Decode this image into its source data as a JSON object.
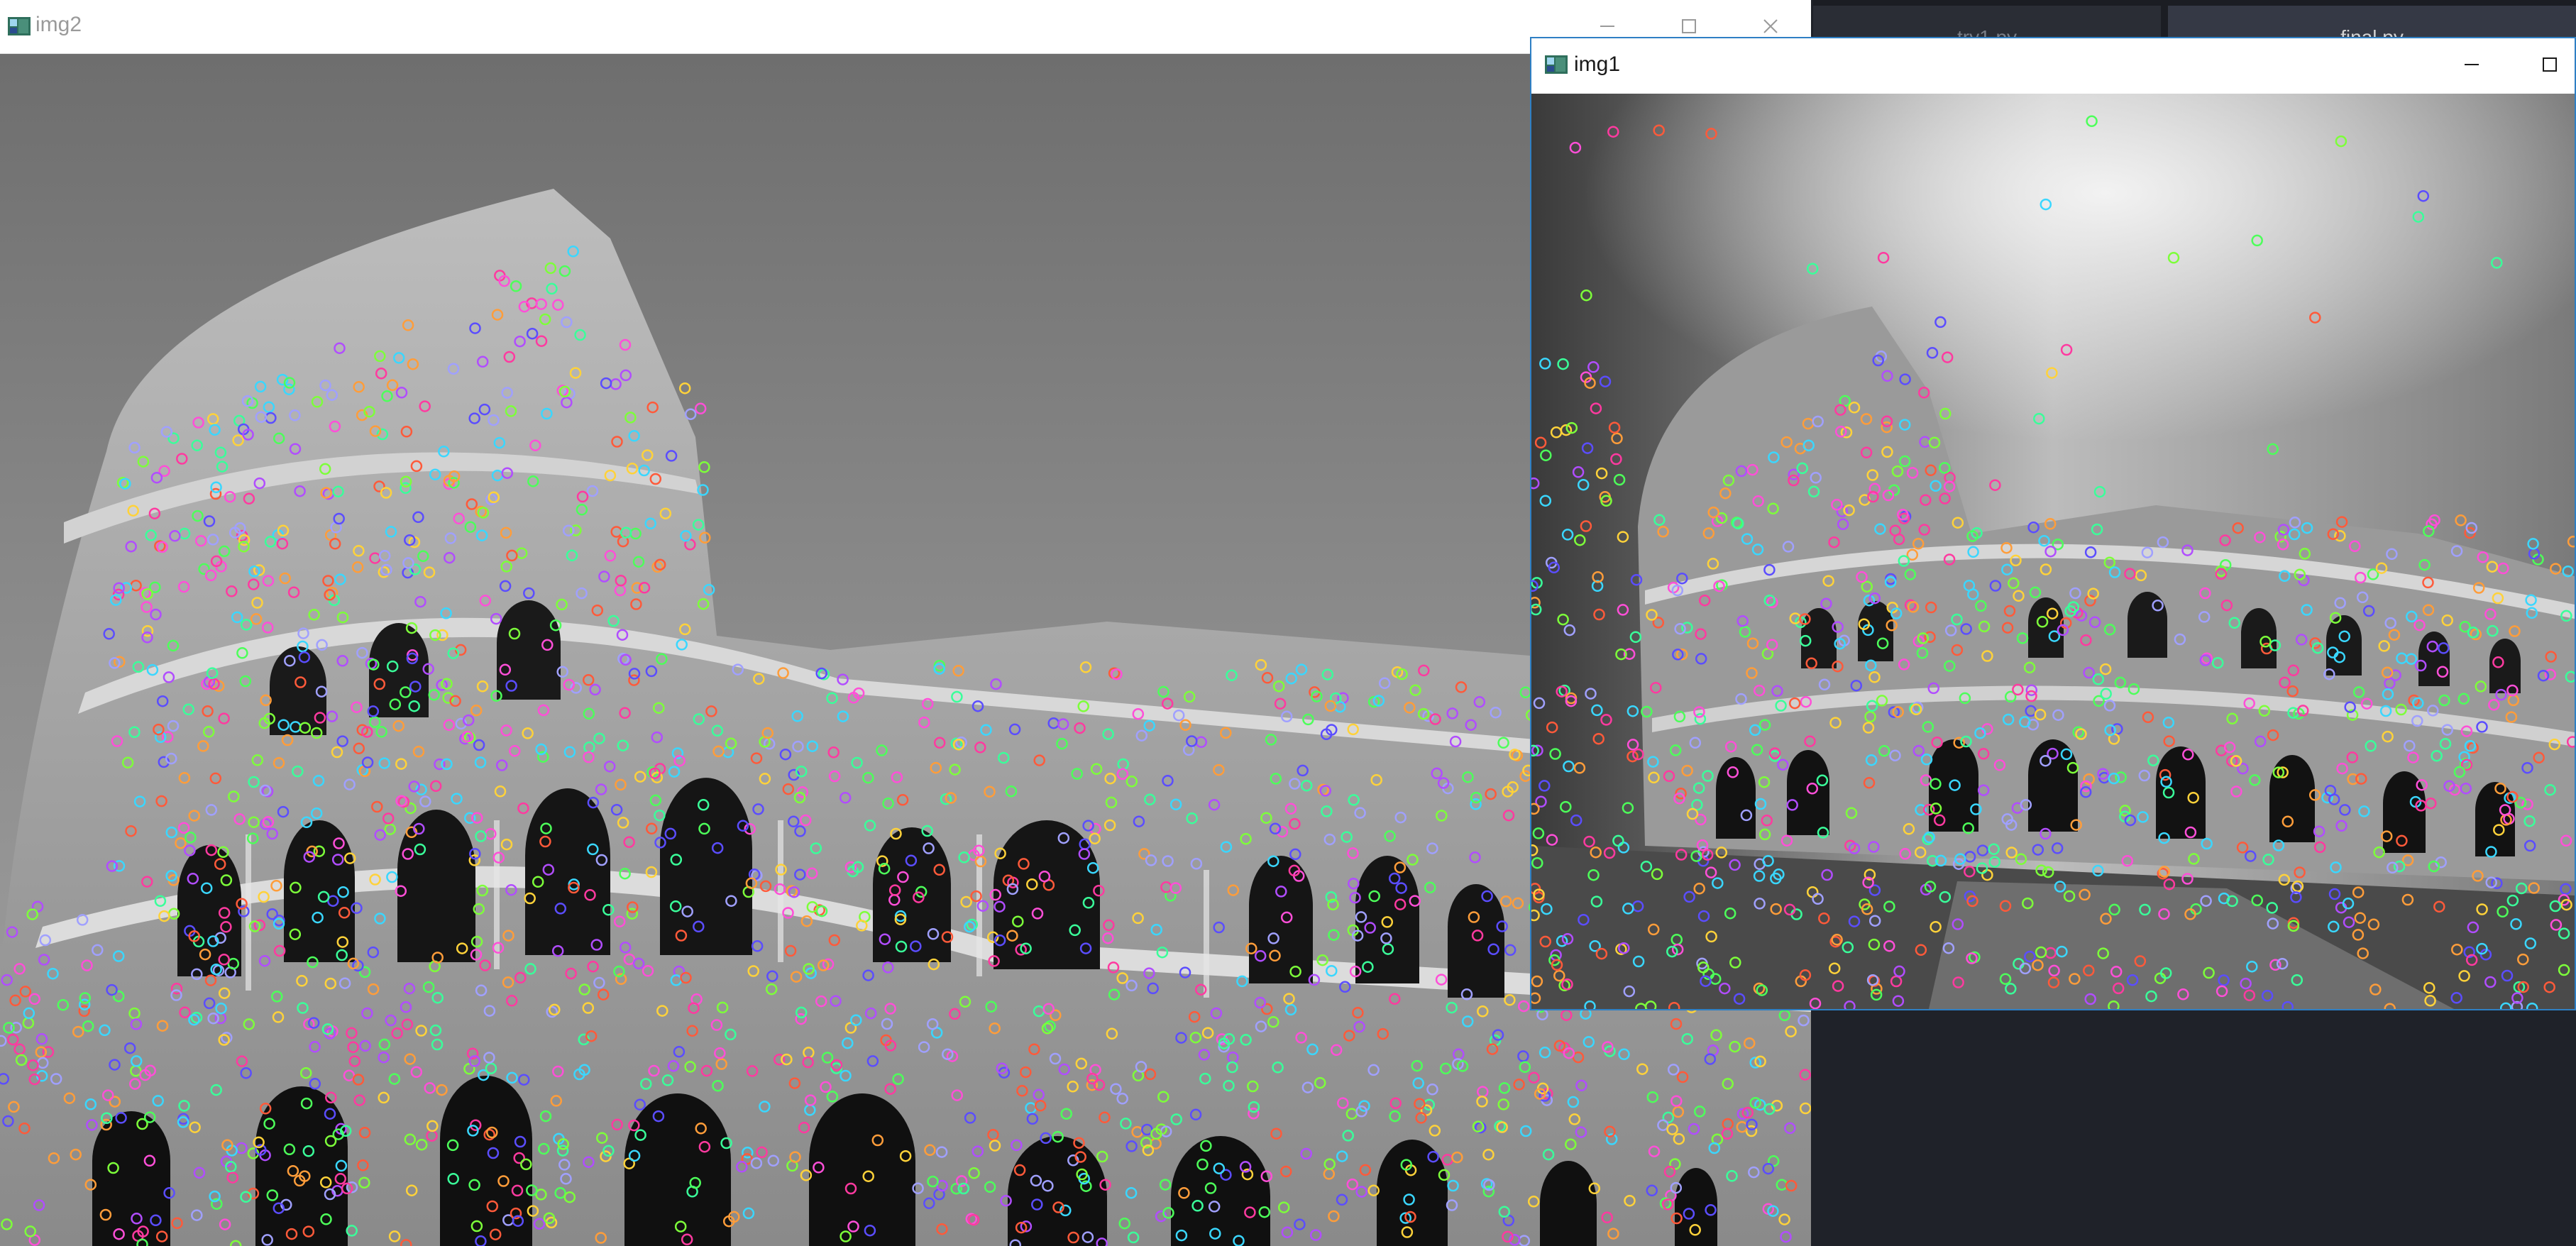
{
  "background_editor": {
    "tabs": [
      "try1.py",
      "final.py"
    ]
  },
  "windows": {
    "img2": {
      "title": "img2",
      "icon": "opencv-window-icon",
      "controls": [
        "minimize-icon",
        "maximize-icon",
        "close-icon"
      ]
    },
    "img1": {
      "title": "img1",
      "icon": "opencv-window-icon",
      "controls": [
        "minimize-icon",
        "maximize-icon"
      ],
      "active": true
    }
  },
  "keypoint_colors": [
    "#ff4fd8",
    "#4dff5a",
    "#5b4dff",
    "#3ad7ff",
    "#ffd23a",
    "#ff5a3a",
    "#b14dff",
    "#7dff3a",
    "#ff3aa0",
    "#3aff9a",
    "#a0a0ff",
    "#ff9d3a"
  ],
  "accent": "#2e7fc4"
}
